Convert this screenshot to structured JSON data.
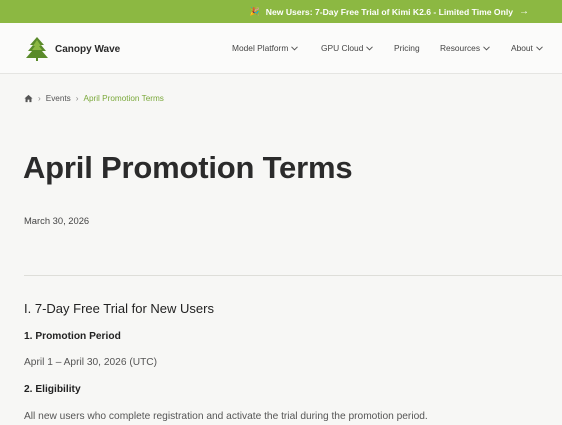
{
  "promo": {
    "icon": "party-popper-icon",
    "text": "New Users: 7-Day Free Trial of Kimi K2.6 - Limited Time Only",
    "arrow": "→"
  },
  "header": {
    "logo_text": "Canopy Wave",
    "nav": [
      {
        "label": "Model Platform",
        "has_dropdown": true
      },
      {
        "label": "GPU Cloud",
        "has_dropdown": true
      },
      {
        "label": "Pricing",
        "has_dropdown": false
      },
      {
        "label": "Resources",
        "has_dropdown": true
      },
      {
        "label": "About",
        "has_dropdown": true
      }
    ]
  },
  "breadcrumb": {
    "sep": "›",
    "items": [
      "Events",
      "April Promotion Terms"
    ]
  },
  "article": {
    "title": "April Promotion Terms",
    "date": "March 30, 2026",
    "section_title": "I. 7-Day Free Trial for New Users",
    "sub1_title": "1. Promotion Period",
    "sub1_text": "April 1 – April 30, 2026 (UTC)",
    "sub2_title": "2. Eligibility",
    "sub2_text": "All new users who complete registration and activate the trial during the promotion period."
  },
  "colors": {
    "accent": "#8cb842",
    "link": "#7aa83a",
    "background": "#f7f7f5"
  }
}
